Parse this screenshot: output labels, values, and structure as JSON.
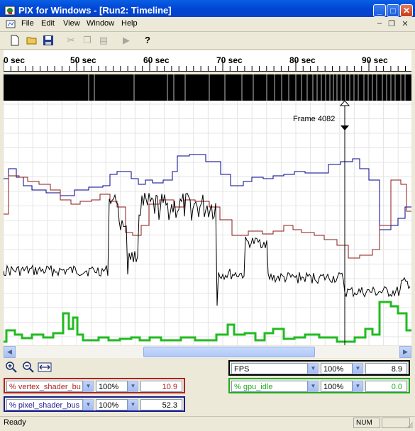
{
  "window": {
    "title": "PIX for Windows - [Run2: Timeline]",
    "minimize_glyph": "_",
    "maximize_glyph": "□",
    "close_glyph": "✕"
  },
  "menu": {
    "items": [
      "File",
      "Edit",
      "View",
      "Window",
      "Help"
    ],
    "mdi_minimize": "–",
    "mdi_restore": "❐",
    "mdi_close": "✕"
  },
  "toolbar": {
    "icons": [
      "new-file-icon",
      "open-folder-icon",
      "save-icon",
      "cut-icon",
      "copy-icon",
      "paste-icon",
      "play-icon",
      "help-icon"
    ]
  },
  "timeline": {
    "ticks": [
      "0 sec",
      "50 sec",
      "60 sec",
      "70 sec",
      "80 sec",
      "90 sec"
    ],
    "frame_marker": "Frame 4082"
  },
  "counters": {
    "left": [
      {
        "name": "% vertex_shader_bu",
        "scale": "100%",
        "value": "10.9",
        "color": "#b22222"
      },
      {
        "name": "% pixel_shader_bus",
        "scale": "100%",
        "value": "52.3",
        "color": "#1c1c8c"
      }
    ],
    "right": [
      {
        "name": "FPS",
        "scale": "100%",
        "value": "8.9",
        "color": "#000000"
      },
      {
        "name": "% gpu_idle",
        "scale": "100%",
        "value": "0.0",
        "color": "#22aa22"
      }
    ]
  },
  "status": {
    "text": "Ready",
    "num": "NUM"
  },
  "colors": {
    "titlebar": "#0a5fe4",
    "series_blue": "#00008b",
    "series_red": "#8b1a1a",
    "series_black": "#000000",
    "series_green": "#22bb22"
  }
}
